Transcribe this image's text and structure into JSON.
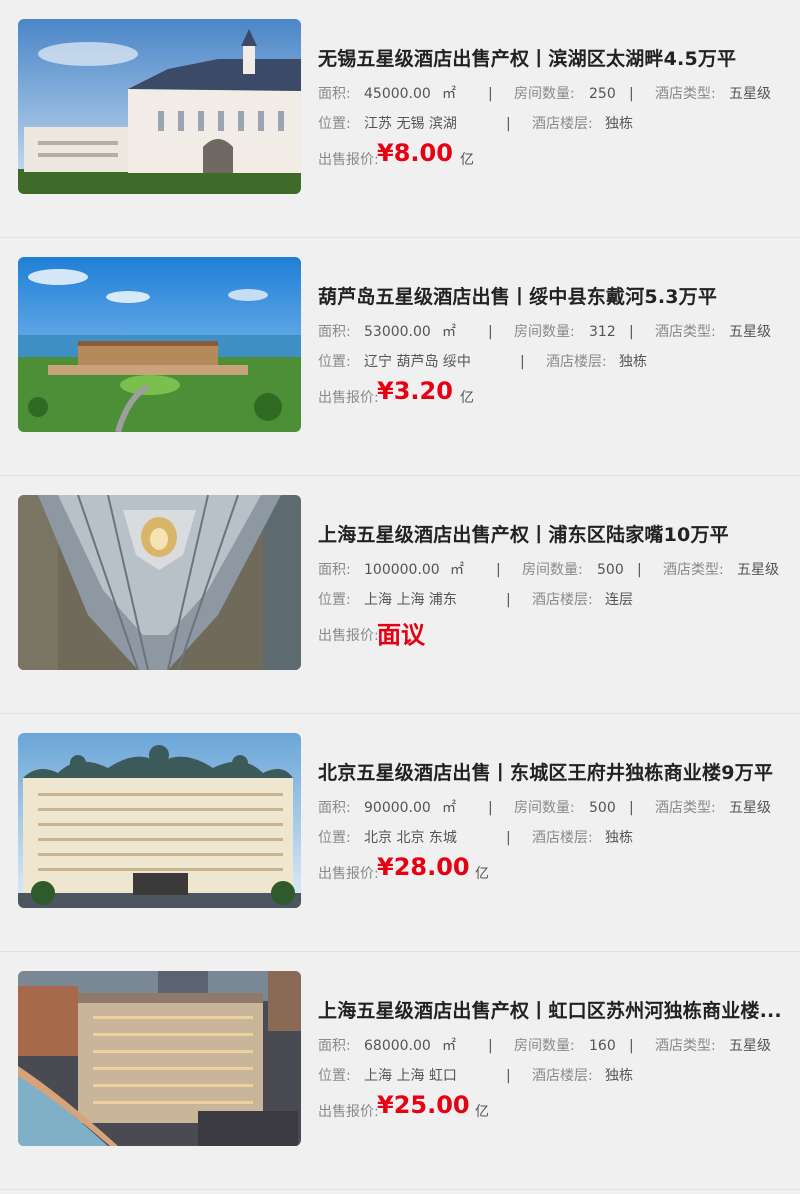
{
  "labels": {
    "area": "面积:",
    "rooms": "房间数量:",
    "type": "酒店类型:",
    "location": "位置:",
    "floors": "酒店楼层:",
    "price": "出售报价:",
    "separator": "|"
  },
  "listings": [
    {
      "title": "无锡五星级酒店出售产权丨滨湖区太湖畔4.5万平",
      "area": "45000.00",
      "area_unit": "㎡",
      "rooms": "250",
      "type": "五星级",
      "location": "江苏 无锡 滨湖",
      "floors": "独栋",
      "price": "¥8.00",
      "price_unit": "亿",
      "image_icon": "hotel-photo-white-castle"
    },
    {
      "title": "葫芦岛五星级酒店出售丨绥中县东戴河5.3万平",
      "area": "53000.00",
      "area_unit": "㎡",
      "rooms": "312",
      "type": "五星级",
      "location": "辽宁 葫芦岛 绥中",
      "floors": "独栋",
      "price": "¥3.20",
      "price_unit": "亿",
      "image_icon": "hotel-photo-seaside-resort"
    },
    {
      "title": "上海五星级酒店出售产权丨浦东区陆家嘴10万平",
      "area": "100000.00",
      "area_unit": "㎡",
      "rooms": "500",
      "type": "五星级",
      "location": "上海 上海 浦东",
      "floors": "连层",
      "price": "面议",
      "price_unit": "",
      "image_icon": "hotel-photo-skyscraper"
    },
    {
      "title": "北京五星级酒店出售丨东城区王府井独栋商业楼9万平",
      "area": "90000.00",
      "area_unit": "㎡",
      "rooms": "500",
      "type": "五星级",
      "location": "北京 北京 东城",
      "floors": "独栋",
      "price": "¥28.00",
      "price_unit": "亿",
      "image_icon": "hotel-photo-classic-palace"
    },
    {
      "title": "上海五星级酒店出售产权丨虹口区苏州河独栋商业楼...",
      "area": "68000.00",
      "area_unit": "㎡",
      "rooms": "160",
      "type": "五星级",
      "location": "上海 上海 虹口",
      "floors": "独栋",
      "price": "¥25.00",
      "price_unit": "亿",
      "image_icon": "hotel-photo-riverside-night"
    }
  ]
}
